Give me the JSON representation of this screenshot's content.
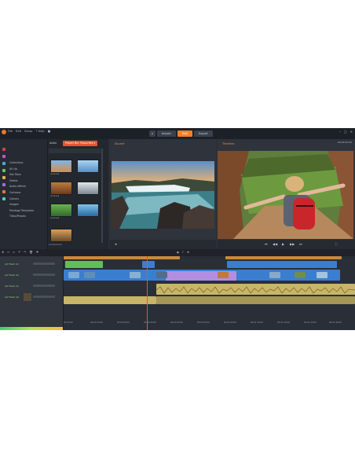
{
  "app": {
    "menu": [
      "File",
      "Edit",
      "Setup",
      "? Help",
      "■"
    ],
    "tabs": {
      "import": "Import",
      "edit": "Edit",
      "export": "Export"
    },
    "window_controls": [
      "–",
      "□",
      "✕"
    ]
  },
  "library": {
    "tab_label": "Audio",
    "add_button": "Project Bin: Favourites ▾",
    "categories": [
      "Collections",
      "All Lib.",
      "Hot Stars",
      "Videos",
      "Audio effects",
      "Cartoons",
      "Colours",
      "Images",
      "Montage Templates",
      "Titles/Presets"
    ],
    "bottom_label": "Lock/Unlock",
    "thumb_caption": "★★★★★"
  },
  "players": {
    "source_title": "Source",
    "timeline_title": "Timeline",
    "timecode": "00:00:00:00"
  },
  "timeline": {
    "tracks": [
      "A/V Track (1)",
      "A/V Track (2)",
      "A/V Track (3)",
      "A/V Track (4)"
    ],
    "ruler": [
      "00:00:00",
      "00:00:10:00",
      "00:00:20:00",
      "00:00:30:00",
      "00:00:40:00",
      "00:00:50:00",
      "00:01:00:00",
      "00:01:10:00",
      "00:01:20:00",
      "00:01:30:00",
      "00:01:40:00"
    ]
  },
  "colors": {
    "accent": "#f47f2c",
    "clip_blue": "#3a7ed0",
    "clip_green": "#5fc154",
    "clip_purple": "#b28ee0",
    "clip_audio": "#c8b56a",
    "clip_gold": "#c98a3b"
  }
}
